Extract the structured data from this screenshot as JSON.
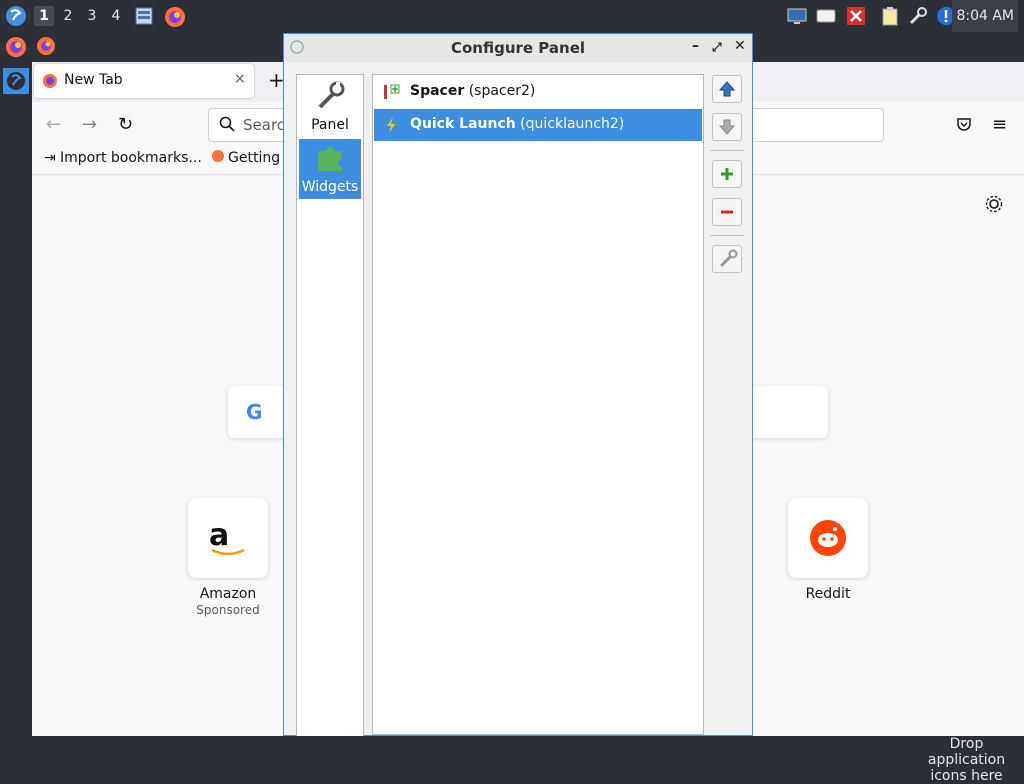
{
  "top_panel": {
    "workspaces": [
      "1",
      "2",
      "3",
      "4"
    ],
    "active_workspace": "1",
    "clock": "8:04 AM",
    "icons": [
      "lxqt-menu-icon",
      "file-manager-icon",
      "firefox-icon",
      "monitor-icon",
      "drive-icon",
      "close-red-icon",
      "clipboard-icon",
      "network-icon",
      "notification-icon"
    ]
  },
  "firefox": {
    "tab_title": "New Tab",
    "tab_close": "×",
    "new_tab": "+",
    "search_placeholder": "Search",
    "bookmarks": [
      "Import bookmarks...",
      "Getting"
    ],
    "tiles": [
      {
        "label": "Amazon",
        "sub": "Sponsored"
      },
      {
        "label": "Reddit",
        "sub": ""
      }
    ]
  },
  "dialog": {
    "title": "Configure Panel",
    "side_items": [
      {
        "label": "Panel",
        "icon": "wrench-icon"
      },
      {
        "label": "Widgets",
        "icon": "puzzle-icon"
      }
    ],
    "widgets": [
      {
        "name": "Spacer",
        "id": "(spacer2)"
      },
      {
        "name": "Quick Launch",
        "id": "(quicklaunch2)"
      }
    ],
    "selected_widget": "Quick Launch",
    "controls": {
      "minimize": "–",
      "restore": "⤢",
      "close": "✕"
    }
  },
  "bottom_panel": {
    "drop_text": "Drop application icons here"
  },
  "colors": {
    "panel_bg": "#2b2f38",
    "selection": "#3d8ee3",
    "dialog_border": "#4a8cd8"
  }
}
